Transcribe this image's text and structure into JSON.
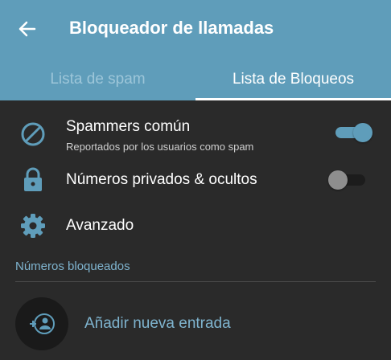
{
  "header": {
    "title": "Bloqueador de llamadas",
    "back_icon": "arrow-left-icon"
  },
  "tabs": [
    {
      "label": "Lista de spam",
      "active": false
    },
    {
      "label": "Lista de Bloqueos",
      "active": true
    }
  ],
  "settings": [
    {
      "icon": "block-icon",
      "title": "Spammers común",
      "subtitle": "Reportados por los usuarios como spam",
      "toggle": "on"
    },
    {
      "icon": "lock-icon",
      "title": "Números privados & ocultos",
      "toggle": "off"
    },
    {
      "icon": "gear-icon",
      "title": "Avanzado"
    }
  ],
  "blocked": {
    "section_label": "Números bloqueados",
    "add_label": "Añadir nueva entrada",
    "add_icon": "add-contact-icon"
  },
  "colors": {
    "accent": "#5f9dba",
    "background": "#2a2a2a",
    "link": "#7fb4cf"
  }
}
